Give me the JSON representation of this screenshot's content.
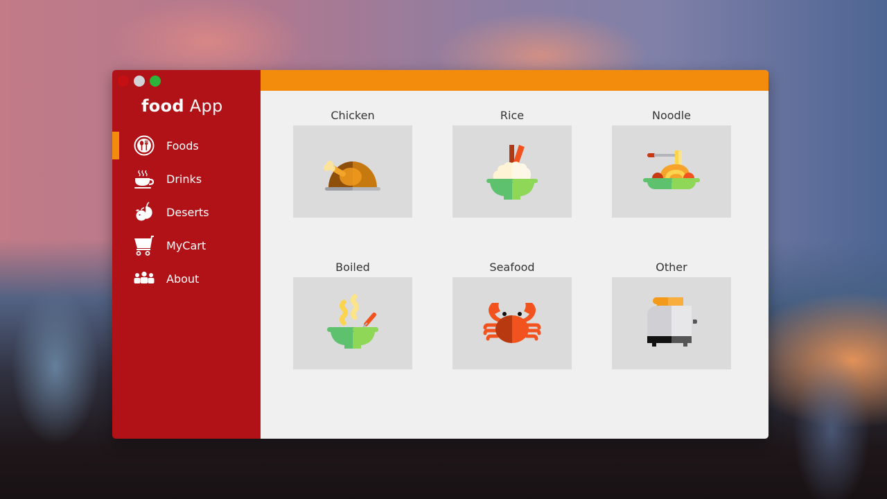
{
  "window": {
    "traffic_lights": [
      "close",
      "minimize",
      "maximize"
    ]
  },
  "brand": {
    "bold": "food",
    "light": "App"
  },
  "sidebar": {
    "items": [
      {
        "label": "Foods",
        "icon": "utensils-icon",
        "active": true
      },
      {
        "label": "Drinks",
        "icon": "coffee-cup-icon",
        "active": false
      },
      {
        "label": "Deserts",
        "icon": "fruit-icon",
        "active": false
      },
      {
        "label": "MyCart",
        "icon": "shopping-cart-icon",
        "active": false
      },
      {
        "label": "About",
        "icon": "people-icon",
        "active": false
      }
    ]
  },
  "categories": [
    {
      "label": "Chicken",
      "icon": "roast-chicken-icon"
    },
    {
      "label": "Rice",
      "icon": "rice-bowl-icon"
    },
    {
      "label": "Noodle",
      "icon": "noodle-plate-icon"
    },
    {
      "label": "Boiled",
      "icon": "soup-bowl-icon"
    },
    {
      "label": "Seafood",
      "icon": "crab-icon"
    },
    {
      "label": "Other",
      "icon": "toaster-icon"
    }
  ],
  "colors": {
    "sidebar": "#b01218",
    "accent": "#f38b0c",
    "content_bg": "#f0f0f0",
    "tile_bg": "#dbdbdb"
  }
}
